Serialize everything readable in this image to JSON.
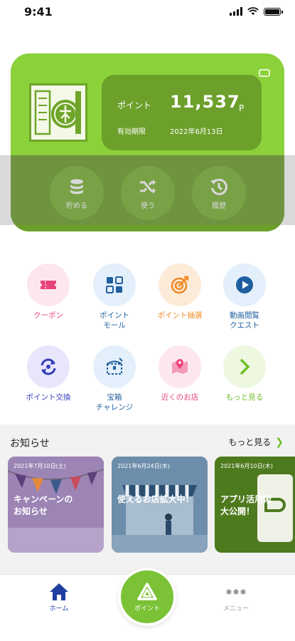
{
  "status": {
    "time": "9:41"
  },
  "card": {
    "point_label": "ポイント",
    "point_value": "11,537",
    "point_unit": "P",
    "expiry_label": "有効期限",
    "expiry_value": "2022年6月13日",
    "actions": [
      {
        "label": "貯める",
        "icon": "coins-icon"
      },
      {
        "label": "使う",
        "icon": "shuffle-icon"
      },
      {
        "label": "履歴",
        "icon": "history-icon"
      }
    ],
    "color": "#8bd13a"
  },
  "menu": [
    {
      "label": "クーポン",
      "icon": "ticket-icon",
      "bg": "#fde7ee",
      "color": "#e8447a"
    },
    {
      "label": "ポイント\nモール",
      "icon": "mall-grid-icon",
      "bg": "#e3effb",
      "color": "#1f5f9f"
    },
    {
      "label": "ポイント抽選",
      "icon": "target-icon",
      "bg": "#fdebd9",
      "color": "#f08a24"
    },
    {
      "label": "動画閲覧\nクエスト",
      "icon": "play-icon",
      "bg": "#e3effb",
      "color": "#1f5f9f"
    },
    {
      "label": "ポイント交換",
      "icon": "exchange-icon",
      "bg": "#e8e6fb",
      "color": "#3740b8"
    },
    {
      "label": "宝箱\nチャレンジ",
      "icon": "treasure-icon",
      "bg": "#e3effb",
      "color": "#1f5f9f"
    },
    {
      "label": "近くのお店",
      "icon": "map-pin-icon",
      "bg": "#fde7ee",
      "color": "#e8447a"
    },
    {
      "label": "もっと見る",
      "icon": "chevron-right-icon",
      "bg": "#eef8e1",
      "color": "#6fc02a"
    }
  ],
  "news": {
    "title": "お知らせ",
    "more": "もっと見る",
    "items": [
      {
        "date": "2021年7月10日(土)",
        "headline": "キャンペーンの\nお知らせ",
        "bg": "#8a6da8"
      },
      {
        "date": "2021年6月24日(木)",
        "headline": "使えるお店拡大中！",
        "bg": "#4f7190"
      },
      {
        "date": "2021年6月10日(木)",
        "headline": "アプリ活用術\n大公開！",
        "bg": "#4e7a1e"
      }
    ]
  },
  "tabs": {
    "home": "ホーム",
    "point": "ポイント",
    "menu": "メニュー"
  }
}
